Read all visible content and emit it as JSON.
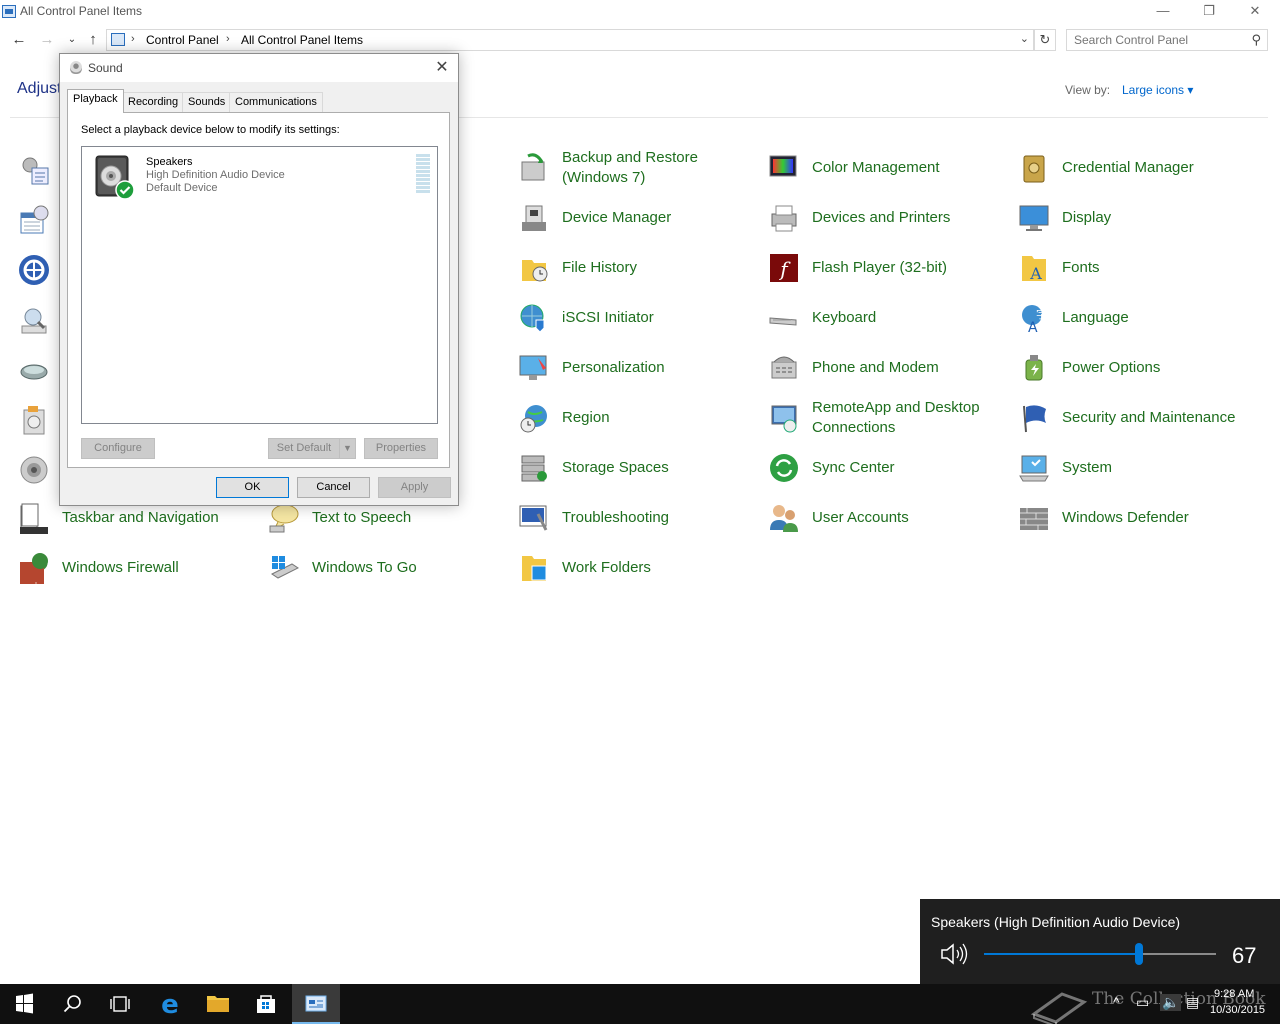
{
  "window": {
    "title": "All Control Panel Items",
    "minimize_glyph": "—",
    "restore_glyph": "❐",
    "close_glyph": "✕"
  },
  "navigation": {
    "breadcrumbs": [
      "Control Panel",
      "All Control Panel Items"
    ],
    "search_placeholder": "Search Control Panel"
  },
  "header": {
    "heading": "Adjust",
    "view_by_label": "View by:",
    "view_by_value": "Large icons ▾"
  },
  "items": [
    {
      "label": "Backup and Restore (Windows 7)",
      "icon": "backup-restore-icon"
    },
    {
      "label": "Color Management",
      "icon": "color-management-icon"
    },
    {
      "label": "Credential Manager",
      "icon": "credential-manager-icon"
    },
    {
      "label": "Device Manager",
      "icon": "device-manager-icon"
    },
    {
      "label": "Devices and Printers",
      "icon": "devices-printers-icon"
    },
    {
      "label": "Display",
      "icon": "display-icon"
    },
    {
      "label": "File History",
      "icon": "file-history-icon"
    },
    {
      "label": "Flash Player (32-bit)",
      "icon": "flash-player-icon"
    },
    {
      "label": "Fonts",
      "icon": "fonts-icon"
    },
    {
      "label": "iSCSI Initiator",
      "icon": "iscsi-initiator-icon"
    },
    {
      "label": "Keyboard",
      "icon": "keyboard-icon"
    },
    {
      "label": "Language",
      "icon": "language-icon"
    },
    {
      "label": "Personalization",
      "icon": "personalization-icon"
    },
    {
      "label": "Phone and Modem",
      "icon": "phone-modem-icon"
    },
    {
      "label": "Power Options",
      "icon": "power-options-icon"
    },
    {
      "label": "Region",
      "icon": "region-icon"
    },
    {
      "label": "RemoteApp and Desktop Connections",
      "icon": "remoteapp-icon"
    },
    {
      "label": "Security and Maintenance",
      "icon": "security-maintenance-icon"
    },
    {
      "label": "Storage Spaces",
      "icon": "storage-spaces-icon"
    },
    {
      "label": "Sync Center",
      "icon": "sync-center-icon"
    },
    {
      "label": "System",
      "icon": "system-icon"
    },
    {
      "label": "Taskbar and Navigation",
      "icon": "taskbar-navigation-icon"
    },
    {
      "label": "Text to Speech",
      "icon": "text-to-speech-icon"
    },
    {
      "label": "Troubleshooting",
      "icon": "troubleshooting-icon"
    },
    {
      "label": "User Accounts",
      "icon": "user-accounts-icon"
    },
    {
      "label": "Windows Defender",
      "icon": "windows-defender-icon"
    },
    {
      "label": "Windows Firewall",
      "icon": "windows-firewall-icon"
    },
    {
      "label": "Windows To Go",
      "icon": "windows-to-go-icon"
    },
    {
      "label": "Work Folders",
      "icon": "work-folders-icon"
    }
  ],
  "sound_dialog": {
    "title": "Sound",
    "tabs": [
      "Playback",
      "Recording",
      "Sounds",
      "Communications"
    ],
    "active_tab": "Playback",
    "instruction": "Select a playback device below to modify its settings:",
    "device": {
      "name": "Speakers",
      "description": "High Definition Audio Device",
      "status": "Default Device"
    },
    "buttons": {
      "configure": "Configure",
      "set_default": "Set Default",
      "properties": "Properties",
      "ok": "OK",
      "cancel": "Cancel",
      "apply": "Apply"
    }
  },
  "volume_flyout": {
    "device_name": "Speakers (High Definition Audio Device)",
    "volume": 67,
    "volume_max": 100,
    "accent": "#0078d7"
  },
  "taskbar": {
    "watermark": "The Collection Book",
    "time": "9:28 AM",
    "date": "10/30/2015"
  }
}
